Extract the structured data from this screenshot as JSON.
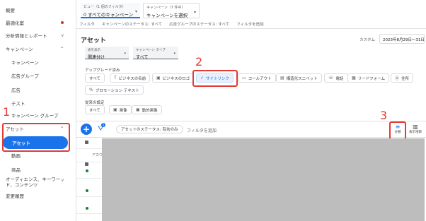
{
  "sidebar": {
    "items": [
      {
        "label": "概要"
      },
      {
        "label": "最適化案"
      },
      {
        "label": "分析情報とレポート"
      },
      {
        "label": "キャンペーン"
      },
      {
        "label": "キャンペーン"
      },
      {
        "label": "広告グループ"
      },
      {
        "label": "広告"
      },
      {
        "label": "テスト"
      },
      {
        "label": "キャンペーン グループ"
      },
      {
        "label": "アセット"
      },
      {
        "label": "アセット"
      },
      {
        "label": "動画"
      },
      {
        "label": "商品"
      },
      {
        "label": "オーディエンス、キーワード、コンテンツ"
      },
      {
        "label": "変更履歴"
      }
    ],
    "chevron_up": "^",
    "chevron_down": "v"
  },
  "header": {
    "view_caption": "ビュー（1 個のフィルタ）",
    "view_value": "すべてのキャンペーン",
    "campaign_caption": "キャンペーン（7 件中）",
    "campaign_value": "キャンペーンを選択"
  },
  "filter_bar": {
    "label": "フィルタ",
    "campaign_status": "キャンペーンのステータス: すべて",
    "adgroup_status": "広告グループのステータス: すべて",
    "add_filter": "フィルタを追加"
  },
  "page": {
    "title": "アセット",
    "date_label": "カスタム",
    "date_range": "2023年8月29日～31日"
  },
  "dropdowns": {
    "display": {
      "caption": "表を表示",
      "value": "関連付け"
    },
    "campaign_type": {
      "caption": "キャンペーン タイプ",
      "value": "すべて"
    }
  },
  "upgrade": {
    "label": "アップグレード済み",
    "chips": [
      {
        "label": "すべて",
        "icon": ""
      },
      {
        "label": "ビジネスの名前",
        "icon": "T"
      },
      {
        "label": "ビジネスのロゴ",
        "icon": "▣"
      },
      {
        "label": "サイトリンク",
        "icon": "✓"
      },
      {
        "label": "コールアウト",
        "icon": "▭"
      },
      {
        "label": "構造化スニペット",
        "icon": "▤"
      },
      {
        "label": "電話",
        "icon": "☏"
      },
      {
        "label": "リードフォーム",
        "icon": "▦"
      },
      {
        "label": "住所",
        "icon": "⦿"
      }
    ],
    "promo_chip": {
      "label": "プロモーション テキスト",
      "icon": "%"
    }
  },
  "unmigrated": {
    "label": "従来の設定",
    "chips": [
      {
        "label": "すべて",
        "icon": ""
      },
      {
        "label": "画像",
        "icon": "▣"
      },
      {
        "label": "動的画像",
        "icon": "▣"
      }
    ]
  },
  "table_toolbar": {
    "add_button": "+",
    "filter_badge": "1",
    "status_chip": "アセットのステータス: 有効のみ",
    "add_filter": "フィルタを追加",
    "segment_label": "分類",
    "columns_label": "表示項目"
  },
  "table": {
    "col_head": "アカウ"
  },
  "annotations": [
    "1",
    "2",
    "3"
  ],
  "colors": {
    "accent": "#1a73e8",
    "annotation": "#e53935",
    "enabled": "#188038"
  }
}
